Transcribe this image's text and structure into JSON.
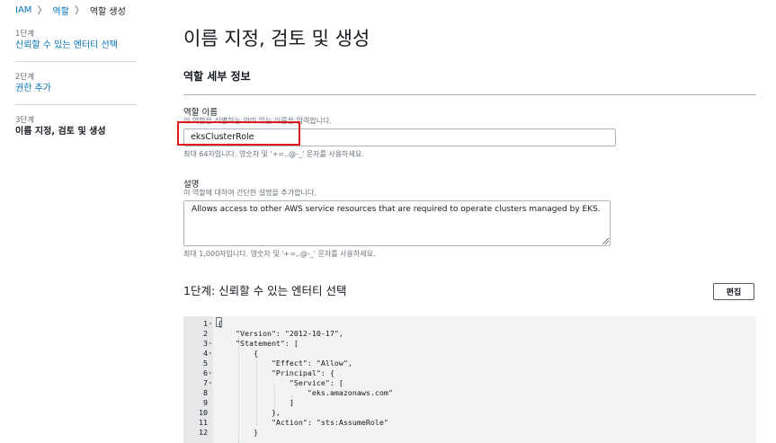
{
  "breadcrumb": {
    "items": [
      "IAM",
      "역할",
      "역할 생성"
    ],
    "separator": "〉"
  },
  "sidenav": {
    "steps": [
      {
        "step": "1단계",
        "label": "신뢰할 수 있는 엔터티 선택"
      },
      {
        "step": "2단계",
        "label": "권한 추가"
      },
      {
        "step": "3단계",
        "label": "이름 지정, 검토 및 생성"
      }
    ]
  },
  "page": {
    "title": "이름 지정, 검토 및 생성",
    "section_title": "역할 세부 정보"
  },
  "role_name": {
    "label": "역할 이름",
    "description": "이 역할을 식별하는 의미 있는 이름을 입력합니다.",
    "value": "eksClusterRole",
    "hint": "최대 64자입니다. 영숫자 및 '+=,.@-_' 문자를 사용하세요."
  },
  "description_field": {
    "label": "설명",
    "description": "이 역할에 대하여 간단한 설명을 추가합니다.",
    "value": "Allows access to other AWS service resources that are required to operate clusters managed by EKS.",
    "hint": "최대 1,000자입니다. 영숫자 및 '+=,.@-_' 문자를 사용하세요."
  },
  "trust_section": {
    "heading": "1단계: 신뢰할 수 있는 엔터티 선택",
    "edit_label": "편집"
  },
  "code": {
    "lines": [
      {
        "n": "1",
        "fold": true,
        "text": "{"
      },
      {
        "n": "2",
        "fold": false,
        "text": "    \"Version\": \"2012-10-17\","
      },
      {
        "n": "3",
        "fold": true,
        "text": "    \"Statement\": ["
      },
      {
        "n": "4",
        "fold": true,
        "text": "        {"
      },
      {
        "n": "5",
        "fold": false,
        "text": "            \"Effect\": \"Allow\","
      },
      {
        "n": "6",
        "fold": true,
        "text": "            \"Principal\": {"
      },
      {
        "n": "7",
        "fold": true,
        "text": "                \"Service\": ["
      },
      {
        "n": "8",
        "fold": false,
        "text": "                    \"eks.amazonaws.com\""
      },
      {
        "n": "9",
        "fold": false,
        "text": "                ]"
      },
      {
        "n": "10",
        "fold": false,
        "text": "            },"
      },
      {
        "n": "11",
        "fold": false,
        "text": "            \"Action\": \"sts:AssumeRole\""
      },
      {
        "n": "12",
        "fold": false,
        "text": "        }"
      }
    ]
  },
  "colors": {
    "link": "#0073bb",
    "highlight": "#e0181b",
    "text": "#16191f"
  }
}
